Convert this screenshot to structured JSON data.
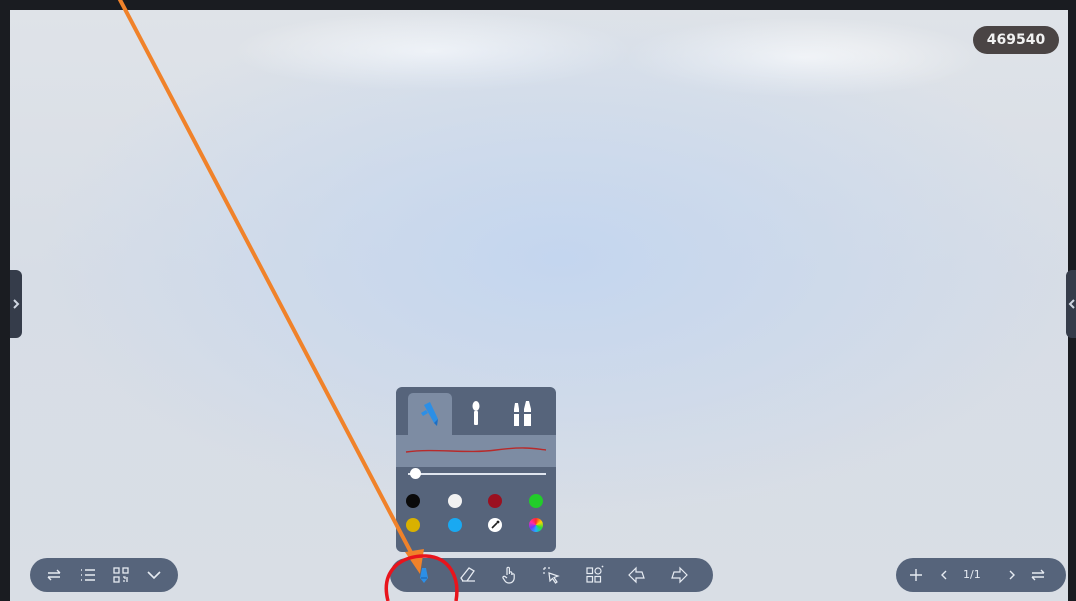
{
  "board": {
    "room_code": "469540"
  },
  "pen_panel": {
    "tabs": [
      {
        "name": "pen",
        "icon": "marker-icon",
        "active": true
      },
      {
        "name": "brush",
        "icon": "brush-icon",
        "active": false
      },
      {
        "name": "dual-pen",
        "icon": "dual-pen-icon",
        "active": false
      }
    ],
    "stroke_color": "#b82a2a",
    "stroke_width": 0.05,
    "colors": [
      "#0a0a0a",
      "#f2f2f2",
      "#9b1020",
      "#22cc2a",
      "#d9b100",
      "#19a9f2",
      "custom-color-picker",
      "color-wheel"
    ]
  },
  "main_toolbar": {
    "tools": [
      "pen-icon",
      "eraser-icon",
      "hand-icon",
      "selection-icon",
      "shapes-icon",
      "undo-icon",
      "redo-icon"
    ],
    "active_tool": "pen-icon"
  },
  "left_toolbar": {
    "tools": [
      "swap-icon",
      "menu-list-icon",
      "qr-code-icon",
      "chevron-down-icon"
    ]
  },
  "right_toolbar": {
    "tools": [
      "add-page-icon",
      "prev-page-icon",
      "next-page-icon",
      "swap-icon"
    ],
    "page_indicator": "1/1"
  },
  "annotation": {
    "arrow_color": "#f0822a",
    "circle_color": "#e8141c"
  }
}
